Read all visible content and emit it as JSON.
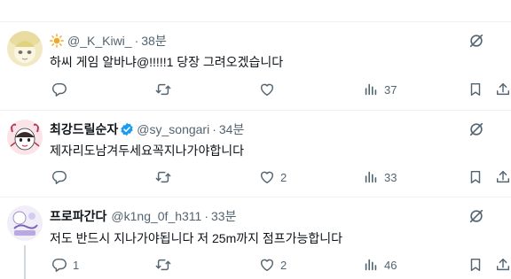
{
  "tweets": [
    {
      "display_name": "@_K_Kiwi_",
      "handle": "",
      "dot": "·",
      "time": "38분",
      "text": "하씨 게임 알바냐@!!!!!1 당장 그려오겠습니다",
      "replies": "",
      "retweets": "",
      "likes": "",
      "views": "37"
    },
    {
      "display_name": "최강드릴순자",
      "handle": "@sy_songari",
      "dot": "·",
      "time": "34분",
      "text": "제자리도남겨두세요꼭지나가야합니다",
      "replies": "",
      "retweets": "",
      "likes": "2",
      "views": "33"
    },
    {
      "display_name": "프로파간다",
      "handle": "@k1ng_0f_h311",
      "dot": "·",
      "time": "33분",
      "text": "저도 반드시 지나가야됩니다  저 25m까지 점프가능합니다",
      "replies": "1",
      "retweets": "",
      "likes": "2",
      "views": "46"
    }
  ],
  "colors": {
    "text_primary": "#0f1419",
    "text_secondary": "#536471",
    "verified": "#1d9bf0",
    "divider": "#eff3f4"
  },
  "icons": [
    "sun-icon",
    "verified-icon",
    "grok-icon",
    "reply-icon",
    "retweet-icon",
    "like-icon",
    "views-icon",
    "bookmark-icon",
    "share-icon"
  ]
}
